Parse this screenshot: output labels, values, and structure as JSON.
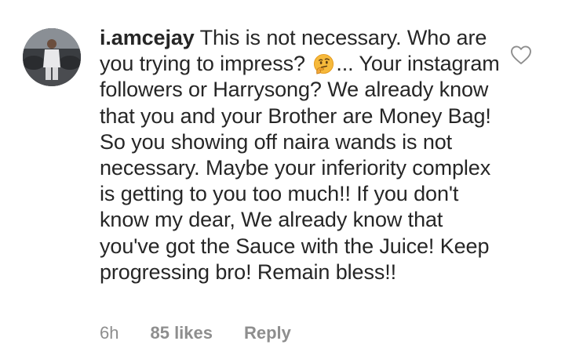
{
  "comment": {
    "username": "i.amcejay",
    "text_before_emoji": " This is not necessary. Who are you trying to impress? ",
    "emoji": "thinking-face-emoji",
    "text_after_emoji": "... Your instagram followers or Harrysong? We already know that you and your Brother are Money Bag!  So you showing off naira wands is not necessary. Maybe your inferiority complex is getting to you too much!! If you don't know my dear, We already know that you've got the Sauce with the Juice! Keep progressing bro! Remain bless!!",
    "time": "6h",
    "likes": "85 likes",
    "reply_label": "Reply",
    "like_icon": "heart-outline-icon"
  },
  "colors": {
    "text": "#262626",
    "muted": "#8e8e8e",
    "background": "#ffffff"
  }
}
